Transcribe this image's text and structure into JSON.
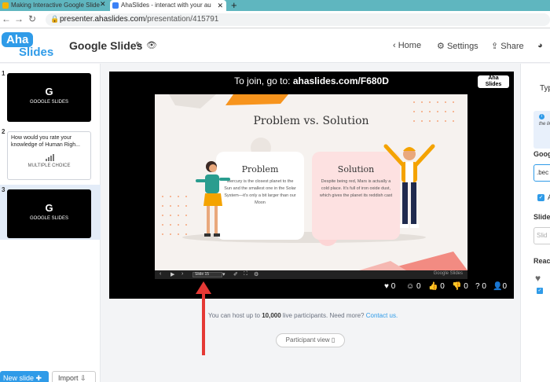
{
  "browser": {
    "tabs": [
      {
        "label": "Making Interactive Google Slide",
        "active": false
      },
      {
        "label": "AhaSlides - interact with your au",
        "active": true
      }
    ],
    "new_tab_label": "+",
    "url_host": "presenter.ahaslides.com",
    "url_path": "/presentation/415791"
  },
  "header": {
    "logo_top": "Aha",
    "logo_bottom": "Slides",
    "presentation_title": "Google Slides",
    "home_label": "Home",
    "settings_label": "Settings",
    "share_label": "Share"
  },
  "sidebar": {
    "slides": [
      {
        "number": "1",
        "kind": "google",
        "icon_letter": "G",
        "caption": "GOOGLE SLIDES"
      },
      {
        "number": "2",
        "kind": "poll",
        "question": "How would you rate your knowledge of Human Righ...",
        "caption": "MULTIPLE CHOICE"
      },
      {
        "number": "3",
        "kind": "google",
        "icon_letter": "G",
        "caption": "GOOGLE SLIDES",
        "selected": true
      }
    ],
    "new_slide_label": "New slide",
    "import_label": "Import"
  },
  "stage": {
    "join_prefix": "To join, go to:",
    "join_url": "ahaslides.com/F680D",
    "logo_top": "Aha",
    "logo_bottom": "Slides",
    "slide": {
      "title": "Problem vs. Solution",
      "left_heading": "Problem",
      "left_body": "Mercury is the closest planet to the Sun and the smallest one in the Solar System—it's only a bit larger than our Moon",
      "right_heading": "Solution",
      "right_body": "Despite being red, Mars is actually a cold place. It's full of iron oxide dust, which gives the planet its reddish cast"
    },
    "toolbar": {
      "prev": "‹",
      "play": "▶",
      "next": "›",
      "slide_select": "Slide 15",
      "brand": "Google Slides"
    },
    "reactions": [
      {
        "name": "heart",
        "glyph": "♥",
        "count": "0"
      },
      {
        "name": "smile",
        "glyph": "☺",
        "count": "0"
      },
      {
        "name": "thumbs-up",
        "glyph": "👍",
        "count": "0"
      },
      {
        "name": "thumbs-down",
        "glyph": "👎",
        "count": "0"
      },
      {
        "name": "question",
        "glyph": "?",
        "count": "0"
      },
      {
        "name": "participants",
        "glyph": "👤",
        "count": "0"
      }
    ]
  },
  "footer_note": {
    "prefix": "You can host up to ",
    "count": "10,000",
    "suffix": " live participants. Need more? ",
    "link": "Contact us."
  },
  "participant_view_label": "Participant view",
  "right_panel": {
    "type_label": "Typ",
    "info_text": "the link",
    "google_label": "Goog",
    "google_input": ".bec",
    "check_label": "A",
    "slide_label": "Slide",
    "slide_input": "Slid",
    "reactions_label": "Reac"
  },
  "colors": {
    "accent": "#2f9be8",
    "tabbar": "#5fb6bf",
    "arrow": "#e53935"
  }
}
